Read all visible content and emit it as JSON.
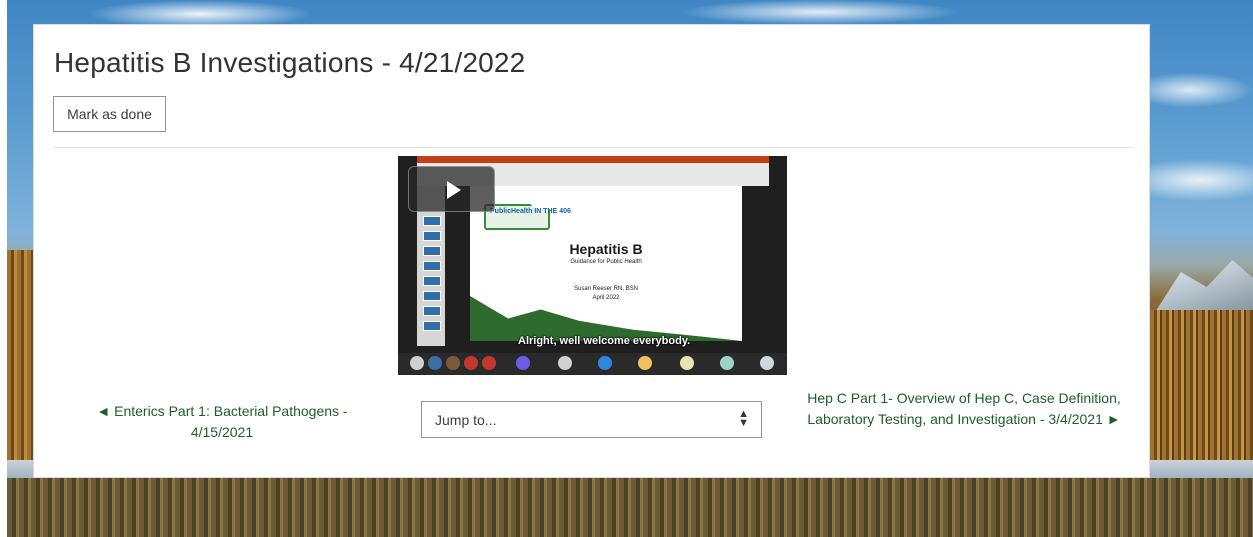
{
  "page": {
    "title": "Hepatitis B Investigations - 4/21/2022",
    "mark_done_label": "Mark as done"
  },
  "video": {
    "slide_logo": "PublicHealth IN THE 406",
    "slide_title": "Hepatitis B",
    "slide_subtitle": "Guidance for Public Health",
    "slide_author": "Susan Reeser RN, BSN",
    "slide_date": "April 2022",
    "caption": "Alright, well welcome everybody.",
    "play_icon": "play-icon"
  },
  "navigation": {
    "prev_label": "◄ Enterics Part 1: Bacterial Pathogens - 4/15/2021",
    "next_label": "Hep C Part 1- Overview of Hep C, Case Definition, Laboratory Testing, and Investigation - 3/4/2021 ►",
    "jump_label": "Jump to...",
    "jump_caret": "▲\n▼"
  },
  "colors": {
    "link": "#1f5e2b",
    "title": "#333333",
    "border": "#8f959e"
  }
}
